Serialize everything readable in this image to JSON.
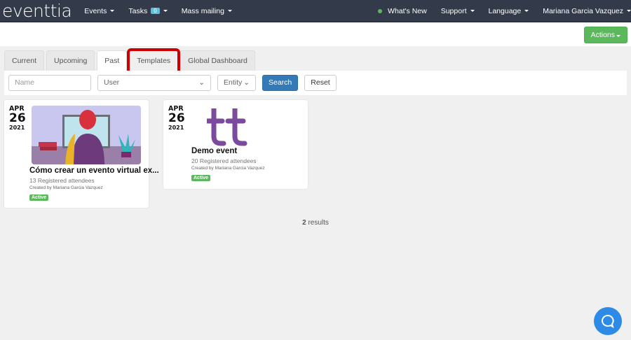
{
  "nav": {
    "logo": "eventtia",
    "events": "Events",
    "tasks": "Tasks",
    "tasks_count": "0",
    "mass_mailing": "Mass mailing",
    "whats_new": "What's New",
    "support": "Support",
    "language": "Language",
    "user": "Mariana Garcia Vazquez"
  },
  "actions_label": "Actions",
  "tabs": [
    "Current",
    "Upcoming",
    "Past",
    "Templates",
    "Global Dashboard"
  ],
  "filters": {
    "name_placeholder": "Name",
    "user": "User",
    "entity": "Entity",
    "search": "Search",
    "reset": "Reset"
  },
  "events": [
    {
      "month": "APR",
      "day": "26",
      "year": "2021",
      "title": "Cómo crear un evento virtual ex...",
      "attendees": "13 Registered attendees",
      "created_by": "Created by Mariana Garcia Vazquez",
      "status": "Active"
    },
    {
      "month": "APR",
      "day": "26",
      "year": "2021",
      "title": "Demo event",
      "attendees": "20 Registered attendees",
      "created_by": "Created by Mariana Garcia Vazquez",
      "status": "Active"
    }
  ],
  "results_count": "2",
  "results_label": "results",
  "colors": {
    "nav": "#333b4b",
    "green": "#5cb85c",
    "blue": "#337ab7",
    "highlight": "#cc0000",
    "logo_purple": "#7b4a9e"
  }
}
